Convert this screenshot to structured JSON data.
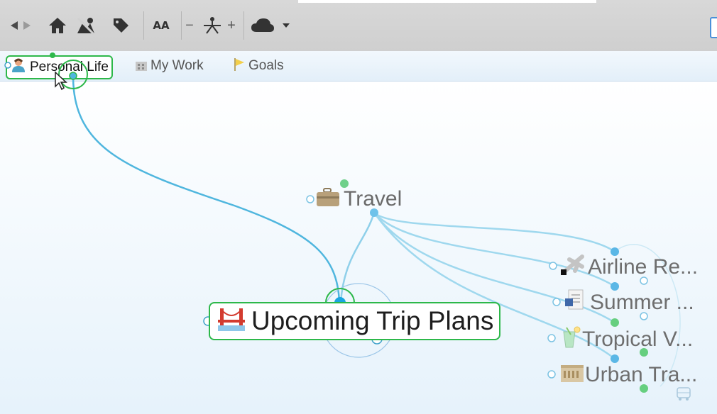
{
  "toolbar": {
    "buttons": [
      {
        "name": "back-icon"
      },
      {
        "name": "forward-icon"
      },
      {
        "name": "home-icon"
      },
      {
        "name": "map-view-icon"
      },
      {
        "name": "tag-icon"
      },
      {
        "name": "font-size-icon",
        "text": "AA"
      },
      {
        "name": "zoom-out-icon",
        "text": "−"
      },
      {
        "name": "layout-icon"
      },
      {
        "name": "zoom-in-icon",
        "text": "+"
      },
      {
        "name": "cloud-icon"
      },
      {
        "name": "dropdown-arrow-icon"
      }
    ]
  },
  "tabs": [
    {
      "label": "Personal Life",
      "icon": "person-icon",
      "active": true
    },
    {
      "label": "My Work",
      "icon": "building-icon",
      "active": false
    },
    {
      "label": "Goals",
      "icon": "flag-icon",
      "active": false
    }
  ],
  "map": {
    "central": {
      "label": "Upcoming Trip Plans",
      "icon": "bridge-icon"
    },
    "parent": {
      "label": "Travel",
      "icon": "suitcase-icon"
    },
    "children": [
      {
        "label": "Airline Re...",
        "icon": "airplane-icon"
      },
      {
        "label": "Summer ...",
        "icon": "document-icon"
      },
      {
        "label": "Tropical V...",
        "icon": "drink-icon"
      },
      {
        "label": "Urban Tra...",
        "icon": "city-icon"
      }
    ]
  },
  "colors": {
    "accent_green": "#2db84a",
    "link_blue": "#4fb6de",
    "node_blue": "#1aa6e0"
  }
}
